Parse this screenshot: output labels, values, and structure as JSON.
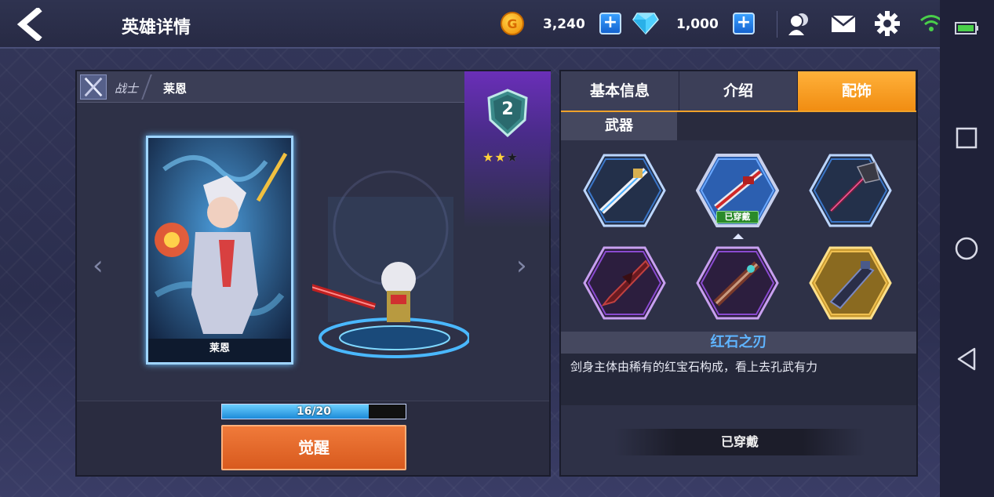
{
  "header": {
    "title": "英雄详情",
    "coins": "3,240",
    "gems": "1,000"
  },
  "hero": {
    "class_label": "战士",
    "name": "莱恩",
    "card_name": "莱恩",
    "level": "2",
    "stars_total": 3,
    "stars_filled": 2,
    "progress_text": "16/20",
    "progress_fraction": 0.8,
    "awaken_label": "觉醒"
  },
  "tabs": [
    {
      "label": "基本信息",
      "active": false
    },
    {
      "label": "介绍",
      "active": false
    },
    {
      "label": "配饰",
      "active": true
    }
  ],
  "subtab": "武器",
  "items": [
    {
      "icon": "blue-white-sword-icon",
      "rarity": "blue"
    },
    {
      "icon": "red-blade-sword-icon",
      "rarity": "blue",
      "equipped_label": "已穿戴",
      "selected": true
    },
    {
      "icon": "dark-spear-icon",
      "rarity": "blue"
    },
    {
      "icon": "crimson-blade-icon",
      "rarity": "purple"
    },
    {
      "icon": "rusted-greatsword-icon",
      "rarity": "purple"
    },
    {
      "icon": "dark-gauntlet-blade-icon",
      "rarity": "gold"
    }
  ],
  "detail": {
    "item_name": "红石之刃",
    "description": "剑身主体由稀有的红宝石构成，看上去孔武有力",
    "status_button": "已穿戴"
  },
  "colors": {
    "accent_orange": "#f18d12",
    "item_name_blue": "#5fb4ff",
    "awaken_orange": "#d85a1e"
  }
}
